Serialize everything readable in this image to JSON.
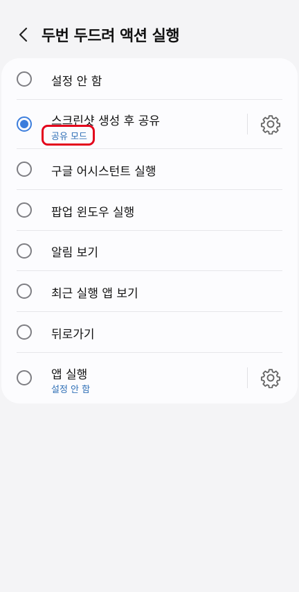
{
  "header": {
    "back_icon": "chevron-left-icon",
    "title": "두번 두드려 액션 실행"
  },
  "options": [
    {
      "label": "설정 안 함",
      "selected": false
    },
    {
      "label": "스크린샷 생성 후 공유",
      "sublabel": "공유 모드",
      "selected": true,
      "settings_icon": "gear-icon"
    },
    {
      "label": "구글 어시스턴트 실행",
      "selected": false
    },
    {
      "label": "팝업 윈도우 실행",
      "selected": false
    },
    {
      "label": "알림 보기",
      "selected": false
    },
    {
      "label": "최근 실행 앱 보기",
      "selected": false
    },
    {
      "label": "뒤로가기",
      "selected": false
    },
    {
      "label": "앱 실행",
      "sublabel": "설정 안 함",
      "selected": false,
      "settings_icon": "gear-icon"
    }
  ],
  "colors": {
    "accent": "#3b7ddc",
    "sublabel": "#2f6fb6",
    "highlight": "#e3001b",
    "background": "#f4f4f6",
    "card": "#fcfcfe"
  }
}
